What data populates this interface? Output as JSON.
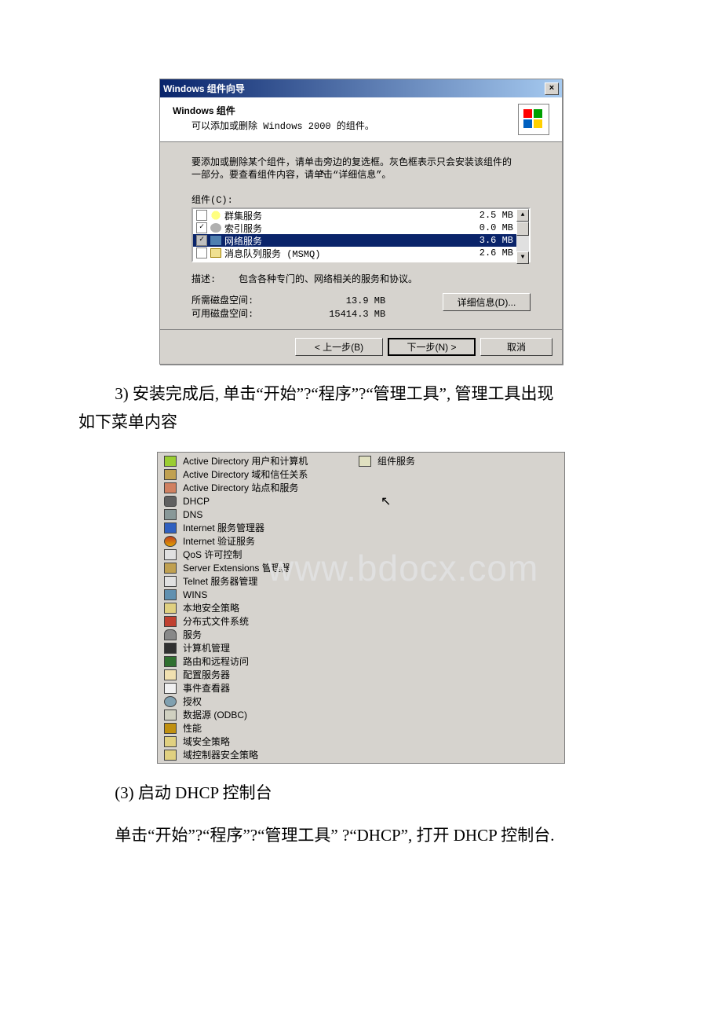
{
  "dialog": {
    "title": "Windows 组件向导",
    "close_x": "×",
    "head_bold": "Windows 组件",
    "head_sub": "可以添加或删除 Windows 2000 的组件。",
    "body_text1": "要添加或删除某个组件，请单击旁边的复选框。灰色框表示只会安装该组件的",
    "body_text2": "一部分。要查看组件内容，请单击“详细信息”。",
    "comp_label": "组件(C):",
    "rows": [
      {
        "checked": false,
        "shade": "",
        "icon": "icon-diamond",
        "name": "群集服务",
        "size": "2.5 MB"
      },
      {
        "checked": true,
        "shade": "",
        "icon": "icon-mag",
        "name": "索引服务",
        "size": "0.0 MB"
      },
      {
        "checked": true,
        "shade": "sel-dark",
        "icon": "icon-net",
        "name": "网络服务",
        "size": "3.6 MB",
        "selected": true
      },
      {
        "checked": false,
        "shade": "",
        "icon": "icon-env",
        "name": "消息队列服务 (MSMQ)",
        "size": "2.6 MB"
      }
    ],
    "desc_label": "描述:",
    "desc_text": "包含各种专门的、网络相关的服务和协议。",
    "req_space_label": "所需磁盘空间:",
    "req_space_value": "13.9 MB",
    "avail_space_label": "可用磁盘空间:",
    "avail_space_value": "15414.3 MB",
    "details_btn": "详细信息(D)...",
    "back_btn": "< 上一步(B)",
    "next_btn": "下一步(N) >",
    "cancel_btn": "取消"
  },
  "para1_a": "3) 安装完成后, 单击“开始”?“程序”?“管理工具”, 管理工具出现",
  "para1_b": "如下菜单内容",
  "menu": {
    "left": [
      {
        "icon": "mi-ad1",
        "label": "Active Directory 用户和计算机"
      },
      {
        "icon": "mi-ad2",
        "label": "Active Directory 域和信任关系"
      },
      {
        "icon": "mi-ad3",
        "label": "Active Directory 站点和服务"
      },
      {
        "icon": "mi-dhcp",
        "label": "DHCP"
      },
      {
        "icon": "mi-dns",
        "label": "DNS"
      },
      {
        "icon": "mi-iis",
        "label": "Internet 服务管理器"
      },
      {
        "icon": "mi-ias",
        "label": "Internet 验证服务"
      },
      {
        "icon": "mi-qos",
        "label": "QoS 许可控制"
      },
      {
        "icon": "mi-se",
        "label": "Server Extensions 管理器"
      },
      {
        "icon": "mi-telnet",
        "label": "Telnet 服务器管理"
      },
      {
        "icon": "mi-wins",
        "label": "WINS"
      },
      {
        "icon": "mi-secpol",
        "label": "本地安全策略"
      },
      {
        "icon": "mi-dfs",
        "label": "分布式文件系统"
      },
      {
        "icon": "mi-services",
        "label": "服务"
      },
      {
        "icon": "mi-compmg",
        "label": "计算机管理"
      },
      {
        "icon": "mi-rras",
        "label": "路由和远程访问"
      },
      {
        "icon": "mi-cfg",
        "label": "配置服务器"
      },
      {
        "icon": "mi-event",
        "label": "事件查看器"
      },
      {
        "icon": "mi-lic",
        "label": "授权"
      },
      {
        "icon": "mi-odbc",
        "label": "数据源 (ODBC)"
      },
      {
        "icon": "mi-perf",
        "label": "性能"
      },
      {
        "icon": "mi-dsec",
        "label": "域安全策略"
      },
      {
        "icon": "mi-dcsec",
        "label": "域控制器安全策略"
      }
    ],
    "right": [
      {
        "icon": "mi-comsvc",
        "label": "组件服务"
      }
    ]
  },
  "watermark": "www.bdocx.com",
  "para2": "(3) 启动 DHCP 控制台",
  "para3": "单击“开始”?“程序”?“管理工具” ?“DHCP”, 打开 DHCP 控制台."
}
